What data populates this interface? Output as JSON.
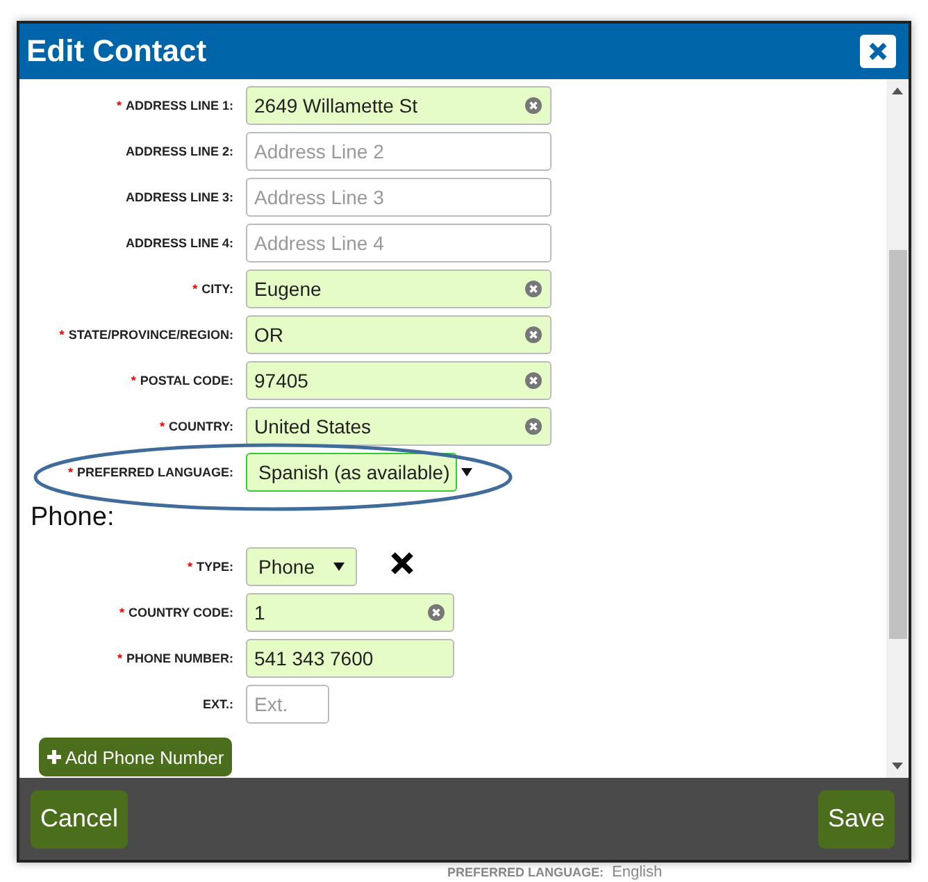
{
  "background": {
    "label": "PREFERRED LANGUAGE:",
    "value": "English"
  },
  "dialog": {
    "title": "Edit Contact"
  },
  "address_fields": [
    {
      "label": "ADDRESS LINE 1:",
      "required_mark": "*",
      "kind": "text",
      "value": "2649 Willamette St",
      "valid": true,
      "clearable": true
    },
    {
      "label": "ADDRESS LINE 2:",
      "kind": "text",
      "placeholder": "Address Line 2",
      "valid": false,
      "clearable": false
    },
    {
      "label": "ADDRESS LINE 3:",
      "kind": "text",
      "placeholder": "Address Line 3",
      "valid": false,
      "clearable": false
    },
    {
      "label": "ADDRESS LINE 4:",
      "kind": "text",
      "placeholder": "Address Line 4",
      "valid": false,
      "clearable": false
    },
    {
      "label": "CITY:",
      "required_mark": "*",
      "kind": "text",
      "value": "Eugene",
      "valid": true,
      "clearable": true
    },
    {
      "label": "STATE/PROVINCE/REGION:",
      "required_mark": "*",
      "kind": "text",
      "value": "OR",
      "valid": true,
      "clearable": true
    },
    {
      "label": "POSTAL CODE:",
      "required_mark": "*",
      "kind": "text",
      "value": "97405",
      "valid": true,
      "clearable": true
    },
    {
      "label": "COUNTRY:",
      "required_mark": "*",
      "kind": "text",
      "value": "United States",
      "valid": true,
      "clearable": true
    },
    {
      "label": "PREFERRED LANGUAGE:",
      "required_mark": "*",
      "kind": "select",
      "value": "Spanish (as available)",
      "valid": true,
      "focused": true,
      "highlighted": true
    }
  ],
  "phone": {
    "heading": "Phone:",
    "fields": [
      {
        "label": "TYPE:",
        "required_mark": "*",
        "kind": "select",
        "value": "Phone",
        "valid": true,
        "removable": true
      },
      {
        "label": "COUNTRY CODE:",
        "required_mark": "*",
        "kind": "text",
        "value": "1",
        "valid": true,
        "clearable": true
      },
      {
        "label": "PHONE NUMBER:",
        "required_mark": "*",
        "kind": "text",
        "value": "541 343 7600",
        "valid": true,
        "clearable": false
      },
      {
        "label": "EXT.:",
        "kind": "extension",
        "placeholder": "Ext.",
        "valid": false,
        "clearable": false
      }
    ],
    "add_button": "Add Phone Number"
  },
  "footer": {
    "buttons": [
      "Cancel",
      "Save"
    ]
  }
}
